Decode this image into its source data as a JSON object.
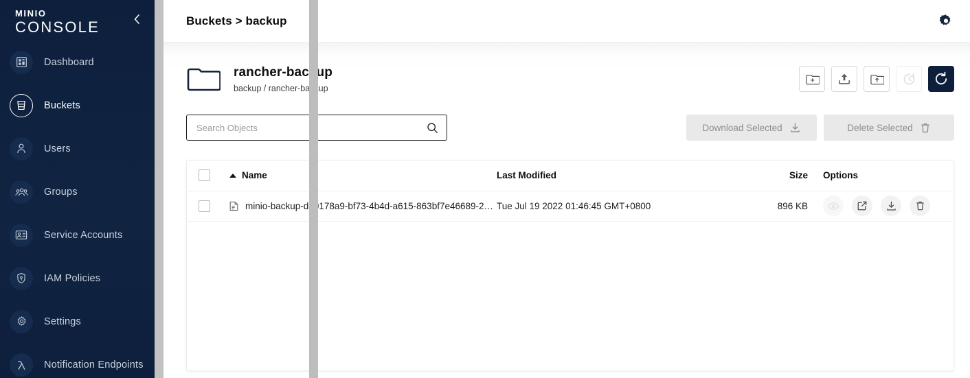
{
  "sidebar": {
    "brand": {
      "minio": "MINIO",
      "console": "CONSOLE"
    },
    "collapse_icon": "chevron-left-icon",
    "items": [
      {
        "label": "Dashboard",
        "icon": "dashboard-icon",
        "active": false
      },
      {
        "label": "Buckets",
        "icon": "bucket-icon",
        "active": true
      },
      {
        "label": "Users",
        "icon": "user-icon",
        "active": false
      },
      {
        "label": "Groups",
        "icon": "groups-icon",
        "active": false
      },
      {
        "label": "Service Accounts",
        "icon": "id-card-icon",
        "active": false
      },
      {
        "label": "IAM Policies",
        "icon": "shield-icon",
        "active": false
      },
      {
        "label": "Settings",
        "icon": "gear-icon",
        "active": false
      },
      {
        "label": "Notification Endpoints",
        "icon": "lambda-icon",
        "active": false
      }
    ]
  },
  "topbar": {
    "breadcrumb": "Buckets > backup",
    "settings_icon": "gear-icon"
  },
  "object_header": {
    "folder_icon": "folder-icon",
    "title": "rancher-backup",
    "subtitle": "backup / rancher-backup",
    "actions": [
      {
        "name": "create-folder-button",
        "icon": "folder-plus-icon",
        "state": "enabled"
      },
      {
        "name": "upload-button",
        "icon": "upload-icon",
        "state": "enabled"
      },
      {
        "name": "upload-folder-button",
        "icon": "folder-upload-icon",
        "state": "enabled"
      },
      {
        "name": "version-history-button",
        "icon": "history-icon",
        "state": "disabled"
      },
      {
        "name": "refresh-button",
        "icon": "refresh-icon",
        "state": "primary"
      }
    ]
  },
  "search": {
    "placeholder": "Search Objects",
    "value": "",
    "icon": "search-icon"
  },
  "selection_actions": {
    "download": {
      "label": "Download Selected",
      "icon": "download-icon",
      "disabled": true
    },
    "delete": {
      "label": "Delete Selected",
      "icon": "trash-icon",
      "disabled": true
    }
  },
  "table": {
    "select_all_checked": false,
    "sort_column": "Name",
    "sort_direction": "asc",
    "columns": {
      "name": "Name",
      "last_modified": "Last Modified",
      "size": "Size",
      "options": "Options"
    },
    "rows": [
      {
        "checked": false,
        "file_icon": "file-icon",
        "name": "minio-backup-da0178a9-bf73-4b4d-a615-863bf7e46689-20…",
        "last_modified": "Tue Jul 19 2022 01:46:45 GMT+0800",
        "size": "896 KB",
        "options": [
          {
            "name": "preview-button",
            "icon": "eye-icon",
            "disabled": true
          },
          {
            "name": "share-button",
            "icon": "share-icon",
            "disabled": false
          },
          {
            "name": "download-button",
            "icon": "download-icon",
            "disabled": false
          },
          {
            "name": "delete-button",
            "icon": "trash-icon",
            "disabled": false
          }
        ]
      }
    ]
  },
  "colors": {
    "sidebar_bg": "#0d1f3c",
    "primary": "#0e1f3c",
    "accent_text": "#c9d2de",
    "muted": "#8d8d8d"
  }
}
